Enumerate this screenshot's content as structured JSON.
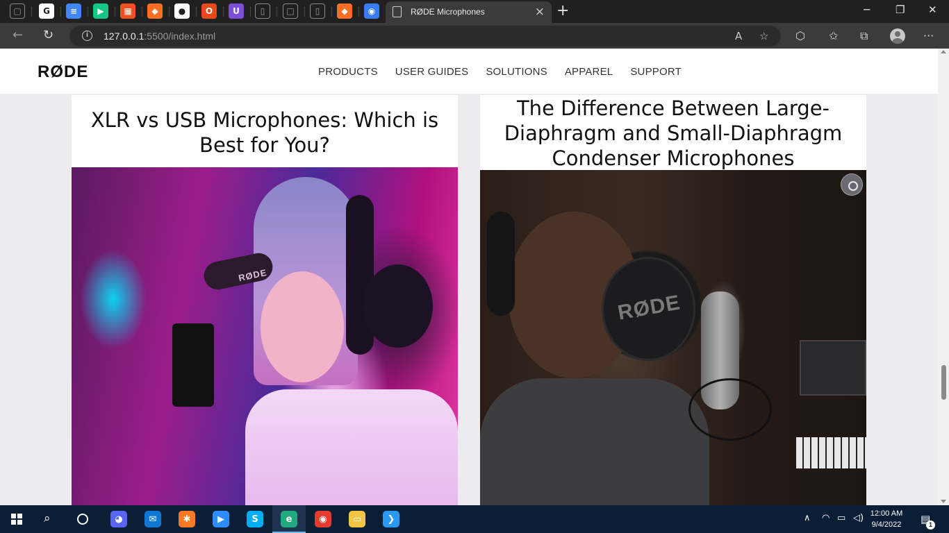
{
  "browser": {
    "pinned_tabs": [
      {
        "icon": "window-icon",
        "color": "#202020",
        "glyph": "▢"
      },
      {
        "icon": "google-icon",
        "color": "#ffffff",
        "glyph": "G"
      },
      {
        "icon": "google-docs-icon",
        "color": "#4285f4",
        "glyph": "≡"
      },
      {
        "icon": "play-icon",
        "color": "#16c784",
        "glyph": "▶"
      },
      {
        "icon": "microsoft-icon",
        "color": "#f25022",
        "glyph": "▦"
      },
      {
        "icon": "gitlab-icon",
        "color": "#fc6d26",
        "glyph": "◆"
      },
      {
        "icon": "github-icon",
        "color": "#ffffff",
        "glyph": "●"
      },
      {
        "icon": "office-icon",
        "color": "#e64a19",
        "glyph": "O"
      },
      {
        "icon": "u-icon",
        "color": "#7b4fd6",
        "glyph": "U"
      },
      {
        "icon": "page-icon",
        "color": "#202020",
        "glyph": "▯"
      },
      {
        "icon": "square-icon",
        "color": "#202020",
        "glyph": "□"
      },
      {
        "icon": "page-icon",
        "color": "#202020",
        "glyph": "▯"
      },
      {
        "icon": "gitlab-icon",
        "color": "#fc6d26",
        "glyph": "◆"
      },
      {
        "icon": "compass-icon",
        "color": "#3a7cf5",
        "glyph": "◉"
      }
    ],
    "active_tab_title": "RØDE Microphones",
    "tab_close": "×",
    "new_tab": "+",
    "url_host": "127.0.0.1",
    "url_path": ":5500/index.html",
    "window_controls": {
      "minimize": "─",
      "maximize": "❐",
      "close": "✕"
    }
  },
  "site": {
    "logo": "RØDE",
    "nav": [
      "PRODUCTS",
      "USER GUIDES",
      "SOLUTIONS",
      "APPAREL",
      "SUPPORT"
    ]
  },
  "articles": [
    {
      "title": "XLR vs USB Microphones: Which is Best for You?",
      "image_label": "RØDE"
    },
    {
      "title": "The Difference Between Large-Diaphragm and Small-Diaphragm Condenser Microphones",
      "image_label": "RØDE"
    }
  ],
  "taskbar": {
    "apps": [
      {
        "icon": "discord-icon",
        "color": "#5865f2",
        "glyph": "◕"
      },
      {
        "icon": "mail-icon",
        "color": "#0f78d4",
        "glyph": "✉"
      },
      {
        "icon": "xampp-icon",
        "color": "#fb7a24",
        "glyph": "✱"
      },
      {
        "icon": "zoom-icon",
        "color": "#2d8cff",
        "glyph": "▶"
      },
      {
        "icon": "skype-icon",
        "color": "#00aff0",
        "glyph": "S"
      },
      {
        "icon": "edge-icon",
        "color": "#1fa97d",
        "glyph": "e"
      },
      {
        "icon": "chrome-icon",
        "color": "#e33b2e",
        "glyph": "◉"
      },
      {
        "icon": "file-explorer-icon",
        "color": "#f4c542",
        "glyph": "▭"
      },
      {
        "icon": "vscode-icon",
        "color": "#2a9af1",
        "glyph": "❯"
      }
    ],
    "time": "12:00 AM",
    "date": "9/4/2022",
    "notifications": "1"
  }
}
